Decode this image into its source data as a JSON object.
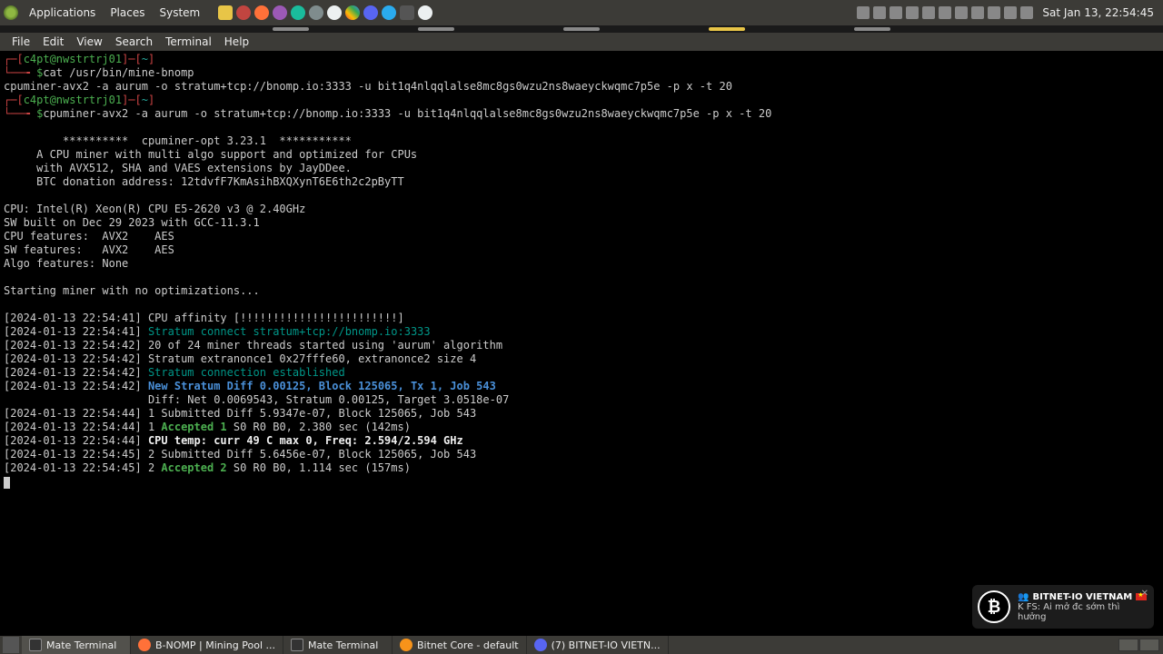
{
  "top_panel": {
    "menus": [
      "Applications",
      "Places",
      "System"
    ],
    "clock": "Sat Jan 13, 22:54:45"
  },
  "menubar": [
    "File",
    "Edit",
    "View",
    "Search",
    "Terminal",
    "Help"
  ],
  "prompt": {
    "user_host": "c4pt@nwstrtrj01",
    "cwd": "~",
    "cmd1": "cat /usr/bin/mine-bnomp",
    "cmd1_out": "cpuminer-avx2 -a aurum -o stratum+tcp://bnomp.io:3333 -u bit1q4nlqqlalse8mc8gs0wzu2ns8waeyckwqmc7p5e -p x -t 20",
    "cmd2": "cpuminer-avx2 -a aurum -o stratum+tcp://bnomp.io:3333 -u bit1q4nlqqlalse8mc8gs0wzu2ns8waeyckwqmc7p5e -p x -t 20"
  },
  "banner": {
    "l1": "         **********  cpuminer-opt 3.23.1  ***********",
    "l2": "     A CPU miner with multi algo support and optimized for CPUs",
    "l3": "     with AVX512, SHA and VAES extensions by JayDDee.",
    "l4": "     BTC donation address: 12tdvfF7KmAsihBXQXynT6E6th2c2pByTT"
  },
  "sysinfo": {
    "cpu": "CPU: Intel(R) Xeon(R) CPU E5-2620 v3 @ 2.40GHz",
    "sw": "SW built on Dec 29 2023 with GCC-11.3.1",
    "cpuf": "CPU features:  AVX2    AES",
    "swf": "SW features:   AVX2    AES",
    "algo": "Algo features: None",
    "start": "Starting miner with no optimizations..."
  },
  "log": [
    {
      "ts": "[2024-01-13 22:54:41] ",
      "txt": "CPU affinity [!!!!!!!!!!!!!!!!!!!!!!!!]",
      "cls": ""
    },
    {
      "ts": "[2024-01-13 22:54:41] ",
      "txt": "Stratum connect stratum+tcp://bnomp.io:3333",
      "cls": "c-teal"
    },
    {
      "ts": "[2024-01-13 22:54:42] ",
      "txt": "20 of 24 miner threads started using 'aurum' algorithm",
      "cls": ""
    },
    {
      "ts": "[2024-01-13 22:54:42] ",
      "txt": "Stratum extranonce1 0x27fffe60, extranonce2 size 4",
      "cls": ""
    },
    {
      "ts": "[2024-01-13 22:54:42] ",
      "txt": "Stratum connection established",
      "cls": "c-teal"
    },
    {
      "ts": "[2024-01-13 22:54:42] ",
      "txt": "New Stratum Diff 0.00125, Block 125065, Tx 1, Job 543",
      "cls": "c-blue"
    },
    {
      "ts": "                      ",
      "txt": "Diff: Net 0.0069543, Stratum 0.00125, Target 3.0518e-07",
      "cls": ""
    },
    {
      "ts": "[2024-01-13 22:54:44] ",
      "txt": "1 Submitted Diff 5.9347e-07, Block 125065, Job 543",
      "cls": ""
    },
    {
      "ts": "[2024-01-13 22:54:44] ",
      "txt_pre": "1 ",
      "accepted": "Accepted 1",
      "txt_post": " S0 R0 B0, 2.380 sec (142ms)",
      "cls": ""
    },
    {
      "ts": "[2024-01-13 22:54:44] ",
      "txt": "CPU temp: curr 49 C max 0, Freq: 2.594/2.594 GHz",
      "cls": "c-bold"
    },
    {
      "ts": "[2024-01-13 22:54:45] ",
      "txt": "2 Submitted Diff 5.6456e-07, Block 125065, Job 543",
      "cls": ""
    },
    {
      "ts": "[2024-01-13 22:54:45] ",
      "txt_pre": "2 ",
      "accepted": "Accepted 2",
      "txt_post": " S0 R0 B0, 1.114 sec (157ms)",
      "cls": ""
    }
  ],
  "taskbar": [
    {
      "label": "Mate Terminal",
      "icon": "term",
      "active": true
    },
    {
      "label": "B-NOMP | Mining Pool ...",
      "icon": "ff",
      "active": false
    },
    {
      "label": "Mate Terminal",
      "icon": "term",
      "active": false
    },
    {
      "label": "Bitnet Core - default",
      "icon": "btc",
      "active": false
    },
    {
      "label": "(7) BITNET-IO VIETN...",
      "icon": "disc",
      "active": false
    }
  ],
  "notif": {
    "title": "BITNET-IO VIETNAM",
    "body": "K FS: Ai mở đc sớm thì hưởng"
  }
}
